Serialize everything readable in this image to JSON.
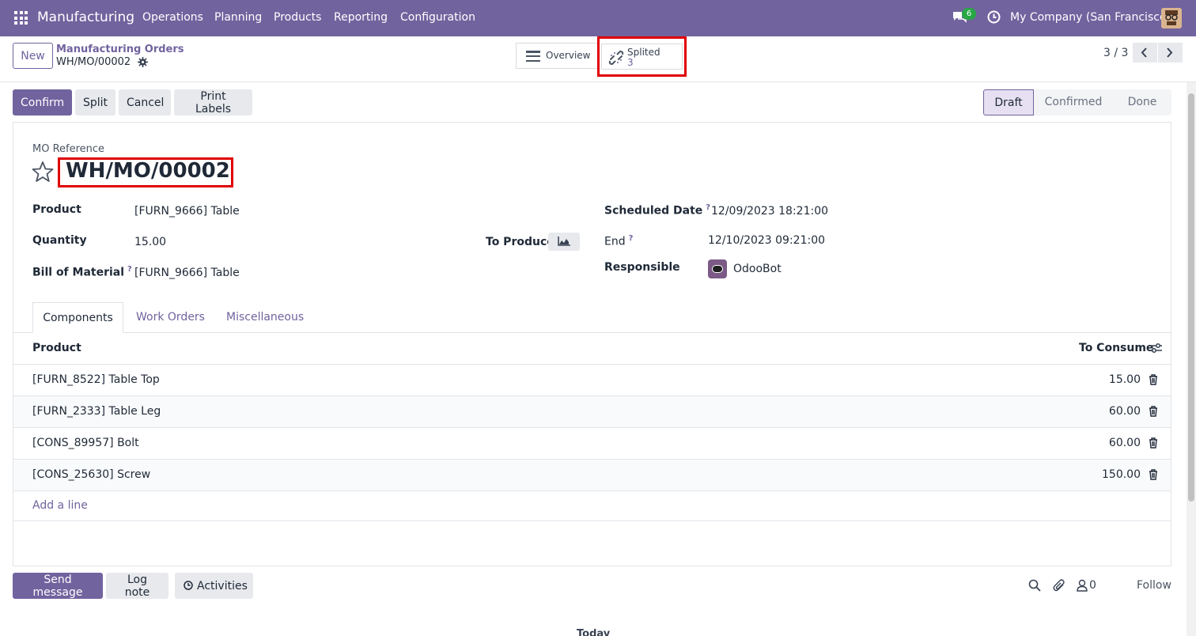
{
  "navbar": {
    "app_name": "Manufacturing",
    "menu": [
      "Operations",
      "Planning",
      "Products",
      "Reporting",
      "Configuration"
    ],
    "chat_badge": "6",
    "company": "My Company (San Francisco)"
  },
  "control_panel": {
    "new_label": "New",
    "breadcrumb_parent": "Manufacturing Orders",
    "breadcrumb_current": "WH/MO/00002",
    "overview_label": "Overview",
    "splited_label": "Splited",
    "splited_count": "3",
    "pager": "3 / 3"
  },
  "actions": {
    "confirm": "Confirm",
    "split": "Split",
    "cancel": "Cancel",
    "print_labels": "Print Labels"
  },
  "statusbar": {
    "draft": "Draft",
    "confirmed": "Confirmed",
    "done": "Done",
    "current": "Draft"
  },
  "form": {
    "mo_reference_label": "MO Reference",
    "mo_reference": "WH/MO/00002",
    "product_label": "Product",
    "product_value": "[FURN_9666] Table",
    "quantity_label": "Quantity",
    "quantity_value": "15.00",
    "to_produce_label": "To Produce",
    "bom_label": "Bill of Material",
    "bom_value": "[FURN_9666] Table",
    "scheduled_label": "Scheduled Date",
    "scheduled_value": "12/09/2023 18:21:00",
    "end_label": "End",
    "end_value": "12/10/2023 09:21:00",
    "responsible_label": "Responsible",
    "responsible_value": "OdooBot",
    "help_mark": "?"
  },
  "tabs": [
    "Components",
    "Work Orders",
    "Miscellaneous"
  ],
  "components": {
    "col_product": "Product",
    "col_to_consume": "To Consume",
    "rows": [
      {
        "product": "[FURN_8522] Table Top",
        "qty": "15.00"
      },
      {
        "product": "[FURN_2333] Table Leg",
        "qty": "60.00"
      },
      {
        "product": "[CONS_89957] Bolt",
        "qty": "60.00"
      },
      {
        "product": "[CONS_25630] Screw",
        "qty": "150.00"
      }
    ],
    "add_line": "Add a line"
  },
  "chatter": {
    "send_message": "Send message",
    "log_note": "Log note",
    "activities": "Activities",
    "followers_count": "0",
    "follow": "Follow",
    "today": "Today"
  },
  "colors": {
    "brand": "#71639e",
    "highlight": "#e00000"
  }
}
